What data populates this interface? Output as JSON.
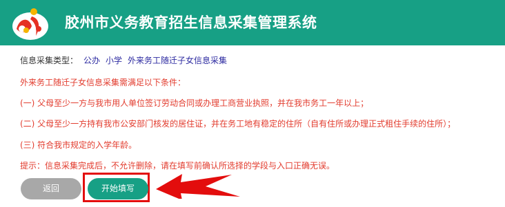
{
  "header": {
    "title": "胶州市义务教育招生信息采集管理系统",
    "logo_icon": "school-emblem-icon",
    "background": "#17a085"
  },
  "info": {
    "type_label": "信息采集类型：",
    "type_values": [
      "公办",
      "小学",
      "外来务工随迁子女信息采集"
    ]
  },
  "conditions": {
    "intro": "外来务工随迁子女信息采集需满足以下条件：",
    "items": [
      "(一) 父母至少一方与我市用人单位签订劳动合同或办理工商营业执照，并在我市务工一年以上；",
      "(二) 父母至少一方持有我市公安部门核发的居住证，并在务工地有稳定的住所（自有住所或办理正式租住手续的住所）；",
      "(三) 符合我市规定的入学年龄。"
    ],
    "tip": "提示：信息采集完成后，不允许删除，请在填写前确认所选择的学段与入口正确无误。",
    "text_color": "#e23b2d"
  },
  "actions": {
    "back_label": "返回",
    "start_label": "开始填写",
    "annotation_color": "#e30d0d",
    "annotation_icon": "red-arrow-icon"
  }
}
